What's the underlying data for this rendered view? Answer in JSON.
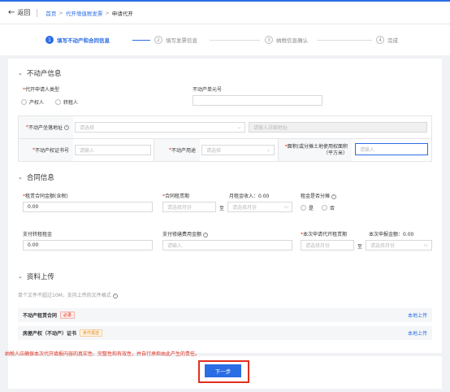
{
  "header": {
    "back_label": "返回",
    "breadcrumb": [
      "首页",
      "代开增值税发票",
      "申请代开"
    ]
  },
  "steps": [
    {
      "num": "1",
      "label": "填写不动产和合同信息",
      "active": true
    },
    {
      "num": "2",
      "label": "填写发票信息",
      "active": false
    },
    {
      "num": "3",
      "label": "纳税信息确认",
      "active": false
    },
    {
      "num": "4",
      "label": "完成",
      "active": false
    }
  ],
  "property": {
    "title": "不动产信息",
    "applicant_type_label": "代开申请人类型",
    "applicant_options": [
      "产权人",
      "转租人"
    ],
    "unit_no_label": "不动产单元号",
    "unit_no_value": "",
    "address_label": "不动产坐落地址",
    "address_select_placeholder": "请选择",
    "address_detail_placeholder": "请输入详细地址",
    "cert_label": "不动产权证书号",
    "cert_placeholder": "请输入",
    "use_label": "不动产用途",
    "use_placeholder": "请选择",
    "area_label": "面积(或分摊土地使用权面积（平方米）",
    "area_placeholder": "请输入"
  },
  "contract": {
    "title": "合同信息",
    "amount_label": "租赁合同金额(含税)",
    "amount_value": "0.00",
    "period_label": "合同租赁期",
    "monthly_label": "月租金收入：0.00",
    "start_placeholder": "请选择月份",
    "to": "至",
    "end_placeholder": "请选择月份",
    "split_label": "租金是否分摊",
    "split_options": [
      "是",
      "否"
    ],
    "transfer_label": "支付转租租金",
    "transfer_value": "0.00",
    "repair_label": "支付修缮费用金额",
    "repair_placeholder": "请输入",
    "current_period_label": "本次申请代开租赁期",
    "current_amount_label": "本次申报金额：0.00",
    "cur_start_placeholder": "请选择月份",
    "cur_end_placeholder": "请选择月份"
  },
  "upload": {
    "title": "资料上传",
    "hint": "单个文件不超过10M，支持上传的文件格式",
    "items": [
      {
        "name": "不动产租赁合同",
        "tag": "必录",
        "tag_color": "red",
        "action": "本地上传"
      },
      {
        "name": "房屋产权（不动产）证书",
        "tag": "条件报送",
        "tag_color": "orange",
        "action": "本地上传"
      }
    ]
  },
  "warning": "纳税人应确保本次代开填报内容的真实性、完整性和有效性，并自行承担由此产生的责任。",
  "next_label": "下一步",
  "colors": {
    "primary": "#2b6de5",
    "required": "#e0301e",
    "highlight_box": "#e0301e"
  }
}
